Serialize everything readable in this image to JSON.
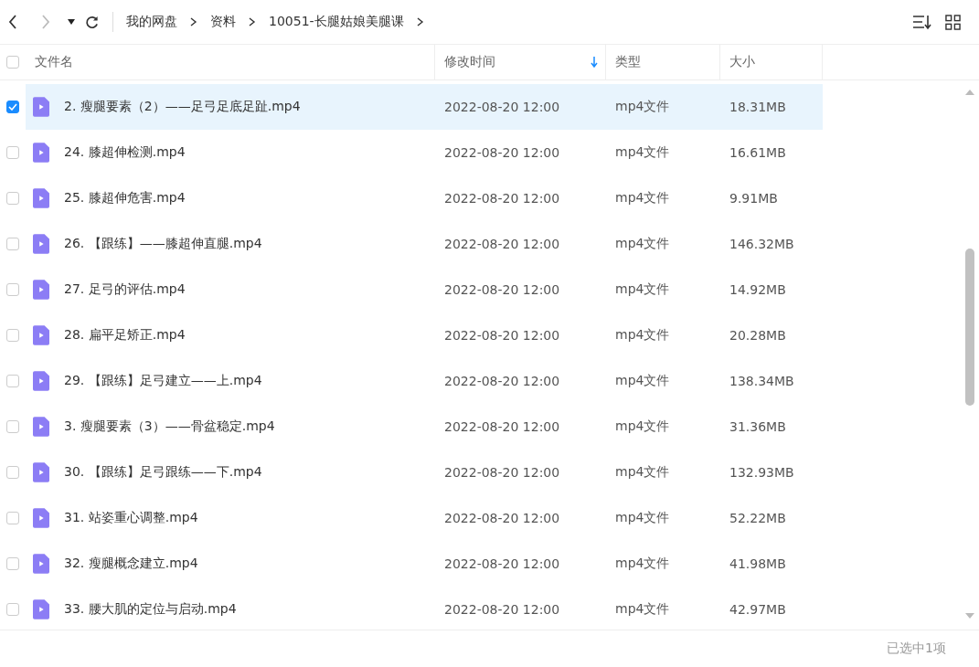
{
  "breadcrumb": [
    "我的网盘",
    "资料",
    "10051-长腿姑娘美腿课"
  ],
  "columns": [
    {
      "label": "文件名",
      "sorted": false
    },
    {
      "label": "修改时间",
      "sorted": true
    },
    {
      "label": "类型",
      "sorted": false
    },
    {
      "label": "大小",
      "sorted": false
    }
  ],
  "header_checked": false,
  "rows": [
    {
      "name": "2. 瘦腿要素（2）——足弓足底足趾.mp4",
      "modified": "2022-08-20 12:00",
      "type": "mp4文件",
      "size": "18.31MB",
      "selected": true
    },
    {
      "name": "24. 膝超伸检测.mp4",
      "modified": "2022-08-20 12:00",
      "type": "mp4文件",
      "size": "16.61MB",
      "selected": false
    },
    {
      "name": "25. 膝超伸危害.mp4",
      "modified": "2022-08-20 12:00",
      "type": "mp4文件",
      "size": "9.91MB",
      "selected": false
    },
    {
      "name": "26. 【跟练】——膝超伸直腿.mp4",
      "modified": "2022-08-20 12:00",
      "type": "mp4文件",
      "size": "146.32MB",
      "selected": false
    },
    {
      "name": "27. 足弓的评估.mp4",
      "modified": "2022-08-20 12:00",
      "type": "mp4文件",
      "size": "14.92MB",
      "selected": false
    },
    {
      "name": "28. 扁平足矫正.mp4",
      "modified": "2022-08-20 12:00",
      "type": "mp4文件",
      "size": "20.28MB",
      "selected": false
    },
    {
      "name": "29. 【跟练】足弓建立——上.mp4",
      "modified": "2022-08-20 12:00",
      "type": "mp4文件",
      "size": "138.34MB",
      "selected": false
    },
    {
      "name": "3. 瘦腿要素（3）——骨盆稳定.mp4",
      "modified": "2022-08-20 12:00",
      "type": "mp4文件",
      "size": "31.36MB",
      "selected": false
    },
    {
      "name": "30. 【跟练】足弓跟练——下.mp4",
      "modified": "2022-08-20 12:00",
      "type": "mp4文件",
      "size": "132.93MB",
      "selected": false
    },
    {
      "name": "31. 站姿重心调整.mp4",
      "modified": "2022-08-20 12:00",
      "type": "mp4文件",
      "size": "52.22MB",
      "selected": false
    },
    {
      "name": "32. 瘦腿概念建立.mp4",
      "modified": "2022-08-20 12:00",
      "type": "mp4文件",
      "size": "41.98MB",
      "selected": false
    },
    {
      "name": "33. 腰大肌的定位与启动.mp4",
      "modified": "2022-08-20 12:00",
      "type": "mp4文件",
      "size": "42.97MB",
      "selected": false
    }
  ],
  "status_bar": "已选中1项"
}
